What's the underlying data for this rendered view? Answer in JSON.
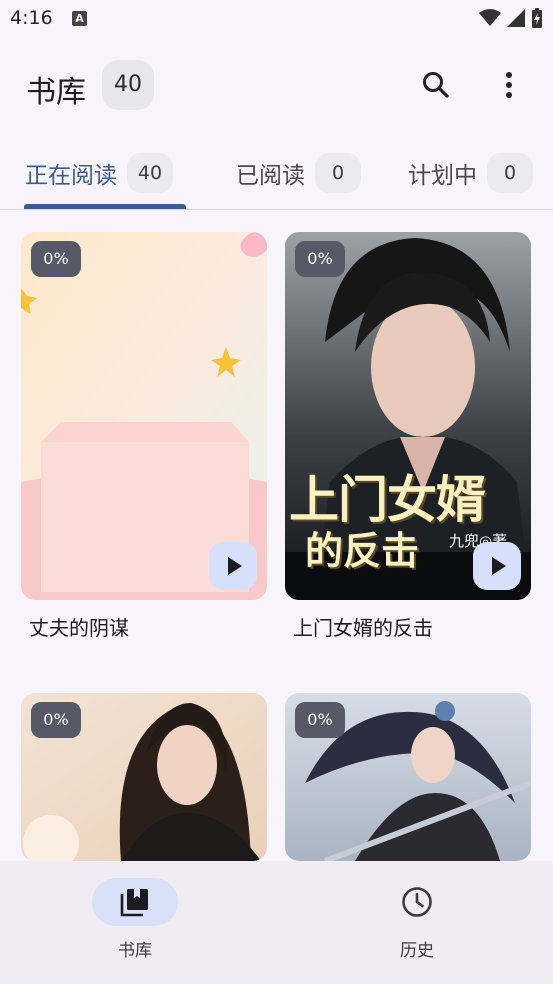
{
  "status": {
    "time": "4:16",
    "notification_glyph": "A"
  },
  "header": {
    "title": "书库",
    "count": "40"
  },
  "tabs": [
    {
      "label": "正在阅读",
      "count": "40"
    },
    {
      "label": "已阅读",
      "count": "0"
    },
    {
      "label": "计划中",
      "count": "0"
    }
  ],
  "books": [
    {
      "title": "丈夫的阴谋",
      "progress": "0%"
    },
    {
      "title": "上门女婿的反击",
      "progress": "0%",
      "cover_title": "上门女婿",
      "cover_subtitle": "的反击",
      "cover_author": "九兜◎著"
    },
    {
      "title": "",
      "progress": "0%"
    },
    {
      "title": "",
      "progress": "0%"
    }
  ],
  "nav": [
    {
      "label": "书库",
      "icon": "library-icon"
    },
    {
      "label": "历史",
      "icon": "clock-icon"
    }
  ],
  "colors": {
    "accent": "#3f5b92",
    "badge": "#585966",
    "play_bg": "#d6e0fb",
    "nav_pill": "#d9e1f9"
  }
}
